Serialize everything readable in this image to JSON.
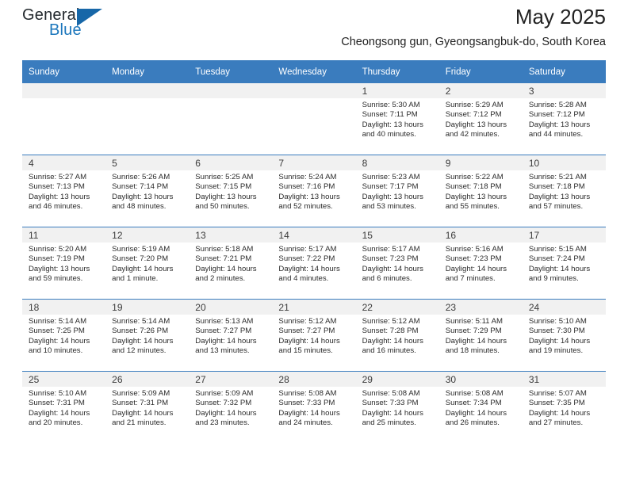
{
  "logo": {
    "word_top": "General",
    "word_bottom": "Blue",
    "triangle_color": "#1767a8",
    "blue_color": "#1b76bc"
  },
  "header": {
    "title": "May 2025",
    "subtitle": "Cheongsong gun, Gyeongsangbuk-do, South Korea"
  },
  "theme": {
    "header_blue": "#3a7cbe",
    "daynum_band": "#f1f1f1"
  },
  "calendar": {
    "weekday_headers": [
      "Sunday",
      "Monday",
      "Tuesday",
      "Wednesday",
      "Thursday",
      "Friday",
      "Saturday"
    ],
    "weeks": [
      [
        {
          "day": "",
          "empty": true
        },
        {
          "day": "",
          "empty": true
        },
        {
          "day": "",
          "empty": true
        },
        {
          "day": "",
          "empty": true
        },
        {
          "day": "1",
          "sunrise": "Sunrise: 5:30 AM",
          "sunset": "Sunset: 7:11 PM",
          "daylight": "Daylight: 13 hours and 40 minutes."
        },
        {
          "day": "2",
          "sunrise": "Sunrise: 5:29 AM",
          "sunset": "Sunset: 7:12 PM",
          "daylight": "Daylight: 13 hours and 42 minutes."
        },
        {
          "day": "3",
          "sunrise": "Sunrise: 5:28 AM",
          "sunset": "Sunset: 7:12 PM",
          "daylight": "Daylight: 13 hours and 44 minutes."
        }
      ],
      [
        {
          "day": "4",
          "sunrise": "Sunrise: 5:27 AM",
          "sunset": "Sunset: 7:13 PM",
          "daylight": "Daylight: 13 hours and 46 minutes."
        },
        {
          "day": "5",
          "sunrise": "Sunrise: 5:26 AM",
          "sunset": "Sunset: 7:14 PM",
          "daylight": "Daylight: 13 hours and 48 minutes."
        },
        {
          "day": "6",
          "sunrise": "Sunrise: 5:25 AM",
          "sunset": "Sunset: 7:15 PM",
          "daylight": "Daylight: 13 hours and 50 minutes."
        },
        {
          "day": "7",
          "sunrise": "Sunrise: 5:24 AM",
          "sunset": "Sunset: 7:16 PM",
          "daylight": "Daylight: 13 hours and 52 minutes."
        },
        {
          "day": "8",
          "sunrise": "Sunrise: 5:23 AM",
          "sunset": "Sunset: 7:17 PM",
          "daylight": "Daylight: 13 hours and 53 minutes."
        },
        {
          "day": "9",
          "sunrise": "Sunrise: 5:22 AM",
          "sunset": "Sunset: 7:18 PM",
          "daylight": "Daylight: 13 hours and 55 minutes."
        },
        {
          "day": "10",
          "sunrise": "Sunrise: 5:21 AM",
          "sunset": "Sunset: 7:18 PM",
          "daylight": "Daylight: 13 hours and 57 minutes."
        }
      ],
      [
        {
          "day": "11",
          "sunrise": "Sunrise: 5:20 AM",
          "sunset": "Sunset: 7:19 PM",
          "daylight": "Daylight: 13 hours and 59 minutes."
        },
        {
          "day": "12",
          "sunrise": "Sunrise: 5:19 AM",
          "sunset": "Sunset: 7:20 PM",
          "daylight": "Daylight: 14 hours and 1 minute."
        },
        {
          "day": "13",
          "sunrise": "Sunrise: 5:18 AM",
          "sunset": "Sunset: 7:21 PM",
          "daylight": "Daylight: 14 hours and 2 minutes."
        },
        {
          "day": "14",
          "sunrise": "Sunrise: 5:17 AM",
          "sunset": "Sunset: 7:22 PM",
          "daylight": "Daylight: 14 hours and 4 minutes."
        },
        {
          "day": "15",
          "sunrise": "Sunrise: 5:17 AM",
          "sunset": "Sunset: 7:23 PM",
          "daylight": "Daylight: 14 hours and 6 minutes."
        },
        {
          "day": "16",
          "sunrise": "Sunrise: 5:16 AM",
          "sunset": "Sunset: 7:23 PM",
          "daylight": "Daylight: 14 hours and 7 minutes."
        },
        {
          "day": "17",
          "sunrise": "Sunrise: 5:15 AM",
          "sunset": "Sunset: 7:24 PM",
          "daylight": "Daylight: 14 hours and 9 minutes."
        }
      ],
      [
        {
          "day": "18",
          "sunrise": "Sunrise: 5:14 AM",
          "sunset": "Sunset: 7:25 PM",
          "daylight": "Daylight: 14 hours and 10 minutes."
        },
        {
          "day": "19",
          "sunrise": "Sunrise: 5:14 AM",
          "sunset": "Sunset: 7:26 PM",
          "daylight": "Daylight: 14 hours and 12 minutes."
        },
        {
          "day": "20",
          "sunrise": "Sunrise: 5:13 AM",
          "sunset": "Sunset: 7:27 PM",
          "daylight": "Daylight: 14 hours and 13 minutes."
        },
        {
          "day": "21",
          "sunrise": "Sunrise: 5:12 AM",
          "sunset": "Sunset: 7:27 PM",
          "daylight": "Daylight: 14 hours and 15 minutes."
        },
        {
          "day": "22",
          "sunrise": "Sunrise: 5:12 AM",
          "sunset": "Sunset: 7:28 PM",
          "daylight": "Daylight: 14 hours and 16 minutes."
        },
        {
          "day": "23",
          "sunrise": "Sunrise: 5:11 AM",
          "sunset": "Sunset: 7:29 PM",
          "daylight": "Daylight: 14 hours and 18 minutes."
        },
        {
          "day": "24",
          "sunrise": "Sunrise: 5:10 AM",
          "sunset": "Sunset: 7:30 PM",
          "daylight": "Daylight: 14 hours and 19 minutes."
        }
      ],
      [
        {
          "day": "25",
          "sunrise": "Sunrise: 5:10 AM",
          "sunset": "Sunset: 7:31 PM",
          "daylight": "Daylight: 14 hours and 20 minutes."
        },
        {
          "day": "26",
          "sunrise": "Sunrise: 5:09 AM",
          "sunset": "Sunset: 7:31 PM",
          "daylight": "Daylight: 14 hours and 21 minutes."
        },
        {
          "day": "27",
          "sunrise": "Sunrise: 5:09 AM",
          "sunset": "Sunset: 7:32 PM",
          "daylight": "Daylight: 14 hours and 23 minutes."
        },
        {
          "day": "28",
          "sunrise": "Sunrise: 5:08 AM",
          "sunset": "Sunset: 7:33 PM",
          "daylight": "Daylight: 14 hours and 24 minutes."
        },
        {
          "day": "29",
          "sunrise": "Sunrise: 5:08 AM",
          "sunset": "Sunset: 7:33 PM",
          "daylight": "Daylight: 14 hours and 25 minutes."
        },
        {
          "day": "30",
          "sunrise": "Sunrise: 5:08 AM",
          "sunset": "Sunset: 7:34 PM",
          "daylight": "Daylight: 14 hours and 26 minutes."
        },
        {
          "day": "31",
          "sunrise": "Sunrise: 5:07 AM",
          "sunset": "Sunset: 7:35 PM",
          "daylight": "Daylight: 14 hours and 27 minutes."
        }
      ]
    ]
  }
}
